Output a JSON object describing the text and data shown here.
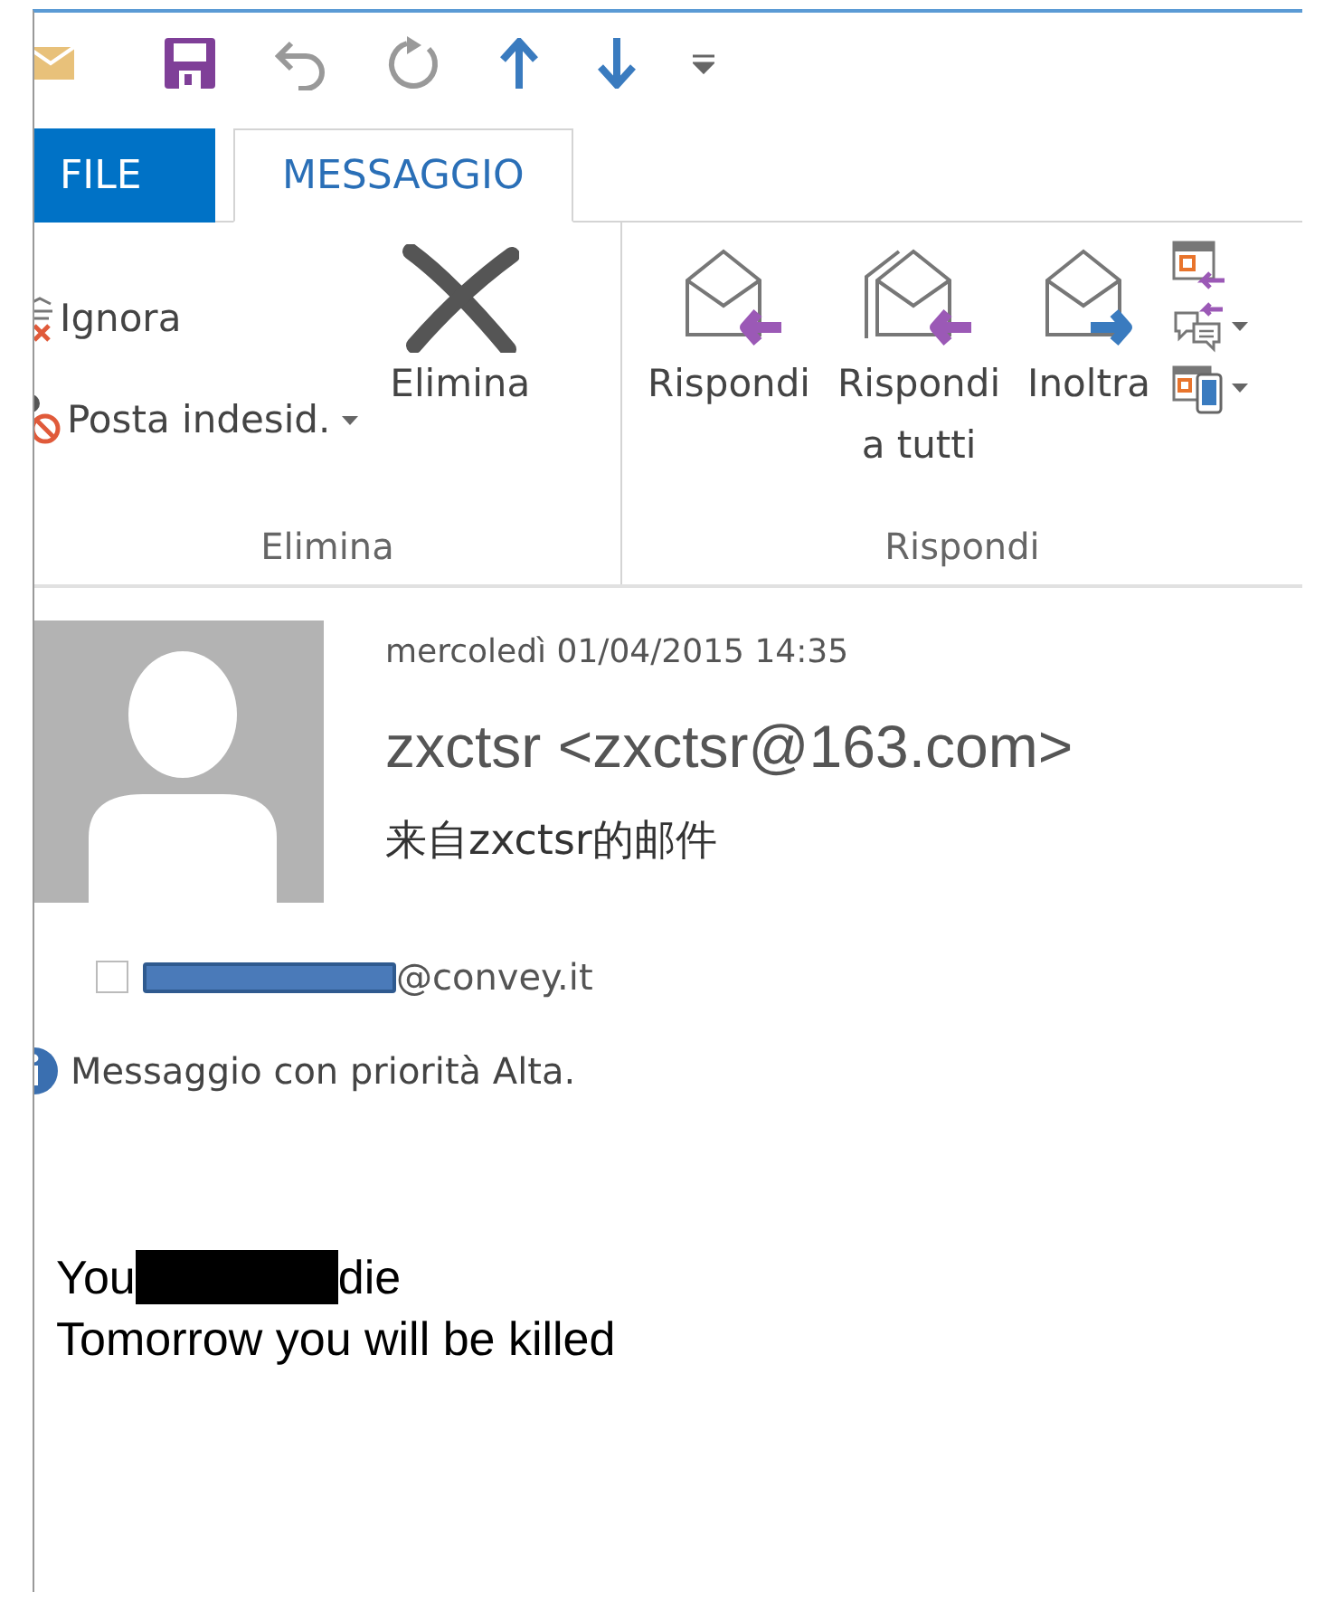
{
  "tabs": [
    {
      "label": "FILE",
      "kind": "file",
      "selected": false
    },
    {
      "label": "MESSAGGIO",
      "kind": "tab",
      "selected": true
    }
  ],
  "ribbon": {
    "groups": [
      {
        "label": "Elimina",
        "items": [
          {
            "kind": "small",
            "label": "Ignora",
            "dropdown": false
          },
          {
            "kind": "small",
            "label": "Posta indesid.",
            "dropdown": true
          },
          {
            "kind": "large",
            "label": "Elimina"
          }
        ]
      },
      {
        "label": "Rispondi",
        "items": [
          {
            "kind": "large",
            "label": "Rispondi"
          },
          {
            "kind": "large",
            "label": "Rispondi a tutti"
          },
          {
            "kind": "large",
            "label": "Inoltra"
          },
          {
            "kind": "icon",
            "dropdown": false
          },
          {
            "kind": "icon",
            "dropdown": true
          },
          {
            "kind": "icon",
            "dropdown": true
          }
        ]
      }
    ]
  },
  "message": {
    "date": "mercoledì 01/04/2015 14:35",
    "sender": "zxctsr <zxctsr@163.com>",
    "subject": "来自zxctsr的邮件",
    "recipient": {
      "checked": false,
      "parts": [
        {
          "kind": "redaction"
        },
        {
          "kind": "text",
          "text": "@convey.it"
        }
      ]
    },
    "info": "Messaggio con priorità Alta.",
    "body": [
      [
        {
          "kind": "text",
          "text": "You"
        },
        {
          "kind": "redaction"
        },
        {
          "kind": "text",
          "text": "die"
        }
      ],
      [
        {
          "kind": "text",
          "text": "Tomorrow you will be killed"
        }
      ]
    ]
  }
}
